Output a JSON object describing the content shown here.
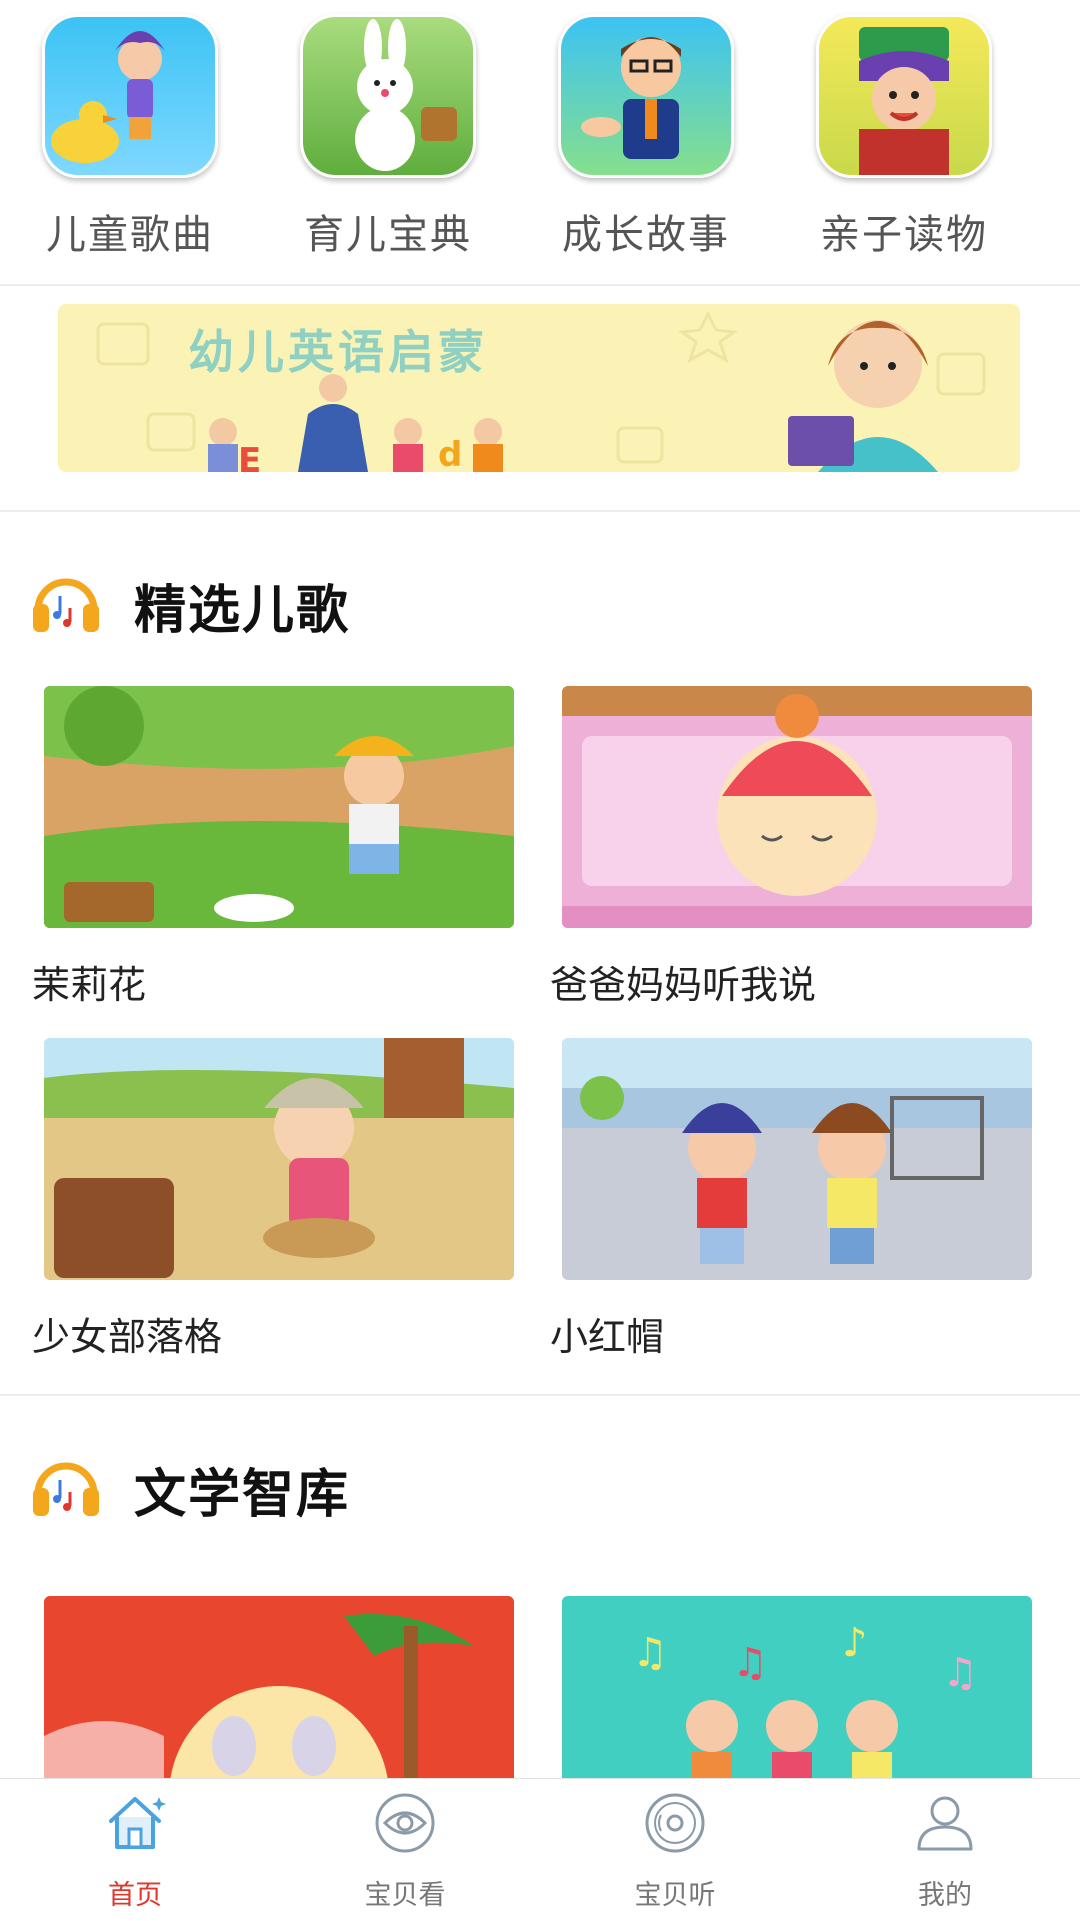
{
  "categories": [
    {
      "label": "儿童歌曲",
      "icon": "cartoon-girl-duck"
    },
    {
      "label": "育儿宝典",
      "icon": "cartoon-rabbit"
    },
    {
      "label": "成长故事",
      "icon": "cartoon-teacher"
    },
    {
      "label": "亲子读物",
      "icon": "cartoon-kid-hat"
    }
  ],
  "banner": {
    "title": "幼儿英语启蒙"
  },
  "sections": [
    {
      "title": "精选儿歌",
      "icon": "headphones-icon",
      "items": [
        {
          "label": "茉莉花"
        },
        {
          "label": "爸爸妈妈听我说"
        },
        {
          "label": "少女部落格"
        },
        {
          "label": "小红帽"
        }
      ]
    },
    {
      "title": "文学智库",
      "icon": "headphones-icon",
      "items": []
    }
  ],
  "nav": [
    {
      "label": "首页",
      "icon": "home-icon",
      "active": true
    },
    {
      "label": "宝贝看",
      "icon": "eye-icon",
      "active": false
    },
    {
      "label": "宝贝听",
      "icon": "disc-icon",
      "active": false
    },
    {
      "label": "我的",
      "icon": "user-icon",
      "active": false
    }
  ],
  "colors": {
    "accent": "#e0362b",
    "nav_icon": "#8a9aa8",
    "home_icon": "#4aa3e0"
  }
}
